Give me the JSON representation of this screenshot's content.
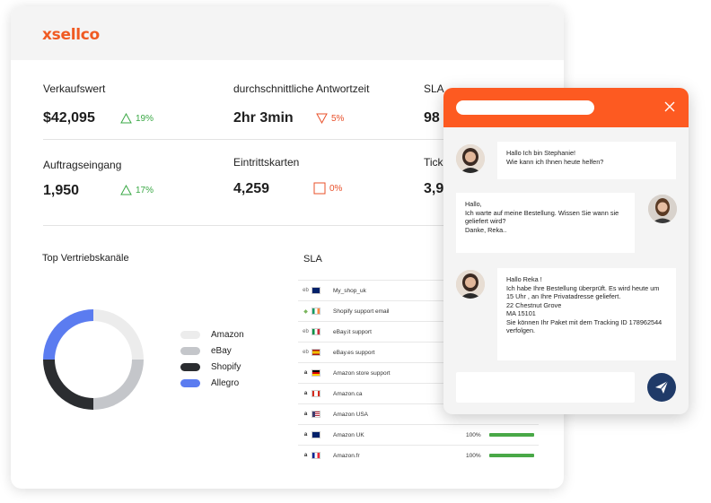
{
  "brand": {
    "logo_text": "xsellco",
    "accent_color": "#f05a22"
  },
  "kpis": {
    "row1": [
      {
        "label": "Verkaufswert",
        "value": "$42,095",
        "trend_icon": "triangle-up-icon",
        "trend": "19%",
        "trend_color": "#3aa845"
      },
      {
        "label": "durchschnittliche Antwortzeit",
        "value": "2hr 3min",
        "trend_icon": "triangle-down-icon",
        "trend": "5%",
        "trend_color": "#e8502a"
      },
      {
        "label": "SLA",
        "value": "98"
      }
    ],
    "row2": [
      {
        "label": "Auftragseingang",
        "value": "1,950",
        "trend_icon": "triangle-up-icon",
        "trend": "17%",
        "trend_color": "#3aa845"
      },
      {
        "label": "Eintrittskarten",
        "value": "4,259",
        "trend_icon": "square-icon",
        "trend": "0%",
        "trend_color": "#e8502a"
      },
      {
        "label": "Tick",
        "value": "3,9"
      }
    ]
  },
  "channels": {
    "title": "Top  Vertriebskanäle",
    "legend": [
      {
        "label": "Amazon",
        "color": "#ececec"
      },
      {
        "label": "eBay",
        "color": "#c4c6ca"
      },
      {
        "label": "Shopify",
        "color": "#2b2d30"
      },
      {
        "label": "Allegro",
        "color": "#5b7cf0"
      }
    ]
  },
  "chart_data": {
    "type": "pie",
    "title": "Top  Vertriebskanäle",
    "categories": [
      "Amazon",
      "eBay",
      "Shopify",
      "Allegro"
    ],
    "values": [
      25,
      25,
      25,
      25
    ],
    "colors": [
      "#ececec",
      "#c4c6ca",
      "#2b2d30",
      "#5b7cf0"
    ],
    "legend": "right"
  },
  "sla": {
    "title": "SLA",
    "rows": [
      {
        "marketplace_icon": "ebay-icon",
        "icon_text": "eb",
        "flag": "uk-flag-icon",
        "name": "My_shop_uk",
        "pct": ""
      },
      {
        "marketplace_icon": "shopify-icon",
        "icon_text": "◆",
        "flag": "ireland-flag-icon",
        "name": "Shopify support email",
        "pct": ""
      },
      {
        "marketplace_icon": "ebay-icon",
        "icon_text": "eb",
        "flag": "italy-flag-icon",
        "name": "eBay.it support",
        "pct": ""
      },
      {
        "marketplace_icon": "ebay-icon",
        "icon_text": "eb",
        "flag": "spain-flag-icon",
        "name": "eBay.es support",
        "pct": ""
      },
      {
        "marketplace_icon": "amazon-icon",
        "icon_text": "a",
        "flag": "germany-flag-icon",
        "name": "Amazon store support",
        "pct": ""
      },
      {
        "marketplace_icon": "amazon-icon",
        "icon_text": "a",
        "flag": "canada-flag-icon",
        "name": "Amazon.ca",
        "pct": ""
      },
      {
        "marketplace_icon": "amazon-icon",
        "icon_text": "a",
        "flag": "usa-flag-icon",
        "name": "Amazon USA",
        "pct": ""
      },
      {
        "marketplace_icon": "amazon-icon",
        "icon_text": "a",
        "flag": "uk-flag-icon",
        "name": "Amazon UK",
        "pct": "100%"
      },
      {
        "marketplace_icon": "amazon-icon",
        "icon_text": "a",
        "flag": "france-flag-icon",
        "name": "Amazon.fr",
        "pct": "100%"
      }
    ]
  },
  "chat": {
    "header_color": "#fd5a21",
    "messages": [
      {
        "from": "agent",
        "text": "Hallo Ich bin Stephanie!\nWie kann ich Ihnen heute helfen?"
      },
      {
        "from": "customer",
        "text": "Hallo,\nIch warte auf meine Bestellung. Wissen Sie wann sie geliefert wird?\nDanke, Reka.."
      },
      {
        "from": "agent",
        "text": "Hallo Reka !\nIch habe Ihre Bestellung überprüft. Es wird heute um 15 Uhr , an Ihre Privatadresse geliefert.\n22 Chestnut Grove\nMA 15101\nSie können Ihr Paket mit dem Tracking ID 178962544 verfolgen."
      }
    ],
    "send_icon": "paper-plane-icon",
    "send_color": "#1f3a68"
  }
}
